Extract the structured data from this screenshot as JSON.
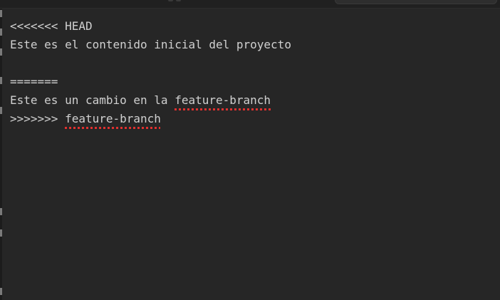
{
  "editor": {
    "lines": [
      {
        "text": "<<<<<<< HEAD"
      },
      {
        "text": "Este es el contenido inicial del proyecto"
      },
      {
        "text": ""
      },
      {
        "text": "======="
      },
      {
        "prefix": "Este es un cambio en la ",
        "flagged": "feature-branch"
      },
      {
        "prefix": ">>>>>>> ",
        "flagged": "feature-branch"
      }
    ]
  },
  "colors": {
    "background": "#262626",
    "text": "#d0d0d0",
    "spell_error_squiggle": "#e0312f"
  }
}
